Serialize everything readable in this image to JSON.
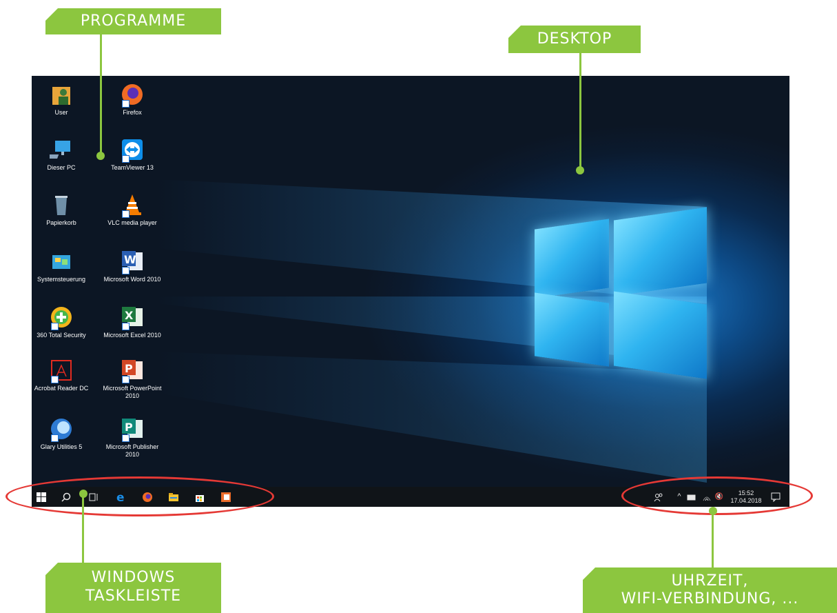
{
  "callouts": {
    "programme": "PROGRAMME",
    "desktop": "DESKTOP",
    "taskleiste_line1": "WINDOWS",
    "taskleiste_line2": "TASKLEISTE",
    "uhrzeit_line1": "UHRZEIT,",
    "uhrzeit_line2": "WIFI-VERBINDUNG, ..."
  },
  "desktop_icons": {
    "col1": [
      "User",
      "Dieser PC",
      "Papierkorb",
      "Systemsteuerung",
      "360 Total Security",
      "Acrobat Reader DC",
      "Glary Utilities 5"
    ],
    "col2": [
      "Firefox",
      "TeamViewer 13",
      "VLC media player",
      "Microsoft Word 2010",
      "Microsoft Excel 2010",
      "Microsoft PowerPoint 2010",
      "Microsoft Publisher 2010"
    ]
  },
  "taskbar": {
    "clock_time": "15:52",
    "clock_date": "17.04.2018"
  },
  "icons": [
    "windows-start-icon",
    "search-icon",
    "task-view-icon",
    "edge-icon",
    "firefox-icon",
    "file-explorer-icon",
    "store-icon",
    "office-icon",
    "people-icon",
    "chevron-up-icon",
    "battery-icon",
    "wifi-icon",
    "speaker-muted-icon",
    "notification-icon"
  ],
  "colors": {
    "accent_green": "#8cc63f",
    "highlight_red": "#e53935",
    "taskbar": "#101418"
  }
}
